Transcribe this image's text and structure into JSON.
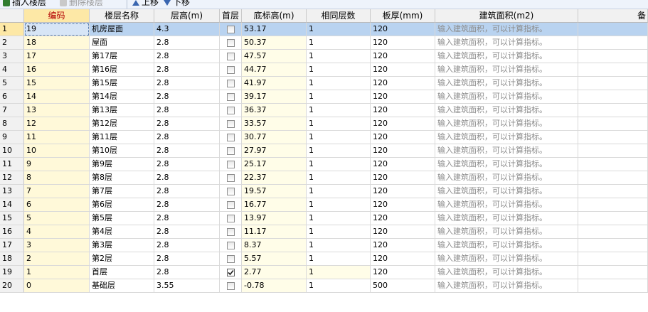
{
  "toolbar": {
    "insert_label": "插入楼层",
    "delete_label": "删除楼层",
    "up_label": "上移",
    "down_label": "下移"
  },
  "columns": [
    "编码",
    "楼层名称",
    "层高(m)",
    "首层",
    "底标高(m)",
    "相同层数",
    "板厚(mm)",
    "建筑面积(m2)",
    "备"
  ],
  "hint_text": "输入建筑面积，可以计算指标。",
  "rows": [
    {
      "num": "1",
      "code": "19",
      "name": "机房屋面",
      "height": "4.3",
      "first": false,
      "bottom": "53.17",
      "same": "1",
      "slab": "120"
    },
    {
      "num": "2",
      "code": "18",
      "name": "屋面",
      "height": "2.8",
      "first": false,
      "bottom": "50.37",
      "same": "1",
      "slab": "120"
    },
    {
      "num": "3",
      "code": "17",
      "name": "第17层",
      "height": "2.8",
      "first": false,
      "bottom": "47.57",
      "same": "1",
      "slab": "120"
    },
    {
      "num": "4",
      "code": "16",
      "name": "第16层",
      "height": "2.8",
      "first": false,
      "bottom": "44.77",
      "same": "1",
      "slab": "120"
    },
    {
      "num": "5",
      "code": "15",
      "name": "第15层",
      "height": "2.8",
      "first": false,
      "bottom": "41.97",
      "same": "1",
      "slab": "120"
    },
    {
      "num": "6",
      "code": "14",
      "name": "第14层",
      "height": "2.8",
      "first": false,
      "bottom": "39.17",
      "same": "1",
      "slab": "120"
    },
    {
      "num": "7",
      "code": "13",
      "name": "第13层",
      "height": "2.8",
      "first": false,
      "bottom": "36.37",
      "same": "1",
      "slab": "120"
    },
    {
      "num": "8",
      "code": "12",
      "name": "第12层",
      "height": "2.8",
      "first": false,
      "bottom": "33.57",
      "same": "1",
      "slab": "120"
    },
    {
      "num": "9",
      "code": "11",
      "name": "第11层",
      "height": "2.8",
      "first": false,
      "bottom": "30.77",
      "same": "1",
      "slab": "120"
    },
    {
      "num": "10",
      "code": "10",
      "name": "第10层",
      "height": "2.8",
      "first": false,
      "bottom": "27.97",
      "same": "1",
      "slab": "120"
    },
    {
      "num": "11",
      "code": "9",
      "name": "第9层",
      "height": "2.8",
      "first": false,
      "bottom": "25.17",
      "same": "1",
      "slab": "120"
    },
    {
      "num": "12",
      "code": "8",
      "name": "第8层",
      "height": "2.8",
      "first": false,
      "bottom": "22.37",
      "same": "1",
      "slab": "120"
    },
    {
      "num": "13",
      "code": "7",
      "name": "第7层",
      "height": "2.8",
      "first": false,
      "bottom": "19.57",
      "same": "1",
      "slab": "120"
    },
    {
      "num": "14",
      "code": "6",
      "name": "第6层",
      "height": "2.8",
      "first": false,
      "bottom": "16.77",
      "same": "1",
      "slab": "120"
    },
    {
      "num": "15",
      "code": "5",
      "name": "第5层",
      "height": "2.8",
      "first": false,
      "bottom": "13.97",
      "same": "1",
      "slab": "120"
    },
    {
      "num": "16",
      "code": "4",
      "name": "第4层",
      "height": "2.8",
      "first": false,
      "bottom": "11.17",
      "same": "1",
      "slab": "120"
    },
    {
      "num": "17",
      "code": "3",
      "name": "第3层",
      "height": "2.8",
      "first": false,
      "bottom": "8.37",
      "same": "1",
      "slab": "120"
    },
    {
      "num": "18",
      "code": "2",
      "name": "第2层",
      "height": "2.8",
      "first": false,
      "bottom": "5.57",
      "same": "1",
      "slab": "120"
    },
    {
      "num": "19",
      "code": "1",
      "name": "首层",
      "height": "2.8",
      "first": true,
      "bottom": "2.77",
      "same": "1",
      "slab": "120"
    },
    {
      "num": "20",
      "code": "0",
      "name": "基础层",
      "height": "3.55",
      "first": false,
      "bottom": "-0.78",
      "same": "1",
      "slab": "500"
    }
  ],
  "icons": [
    "insert-floor-icon",
    "delete-floor-icon",
    "move-up-icon",
    "move-down-icon",
    "checkmark-icon"
  ]
}
